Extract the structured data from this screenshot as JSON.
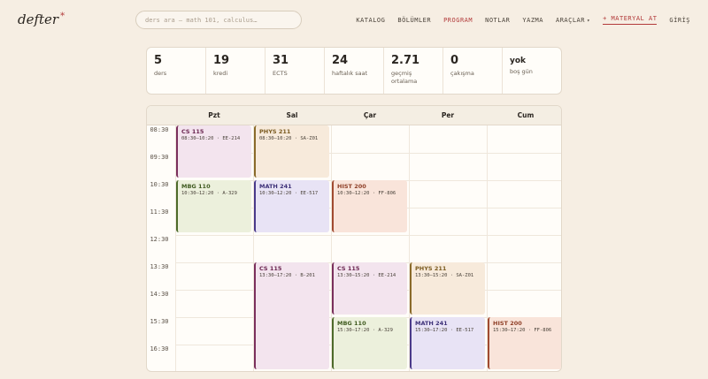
{
  "header": {
    "logo": "defter",
    "logo_mark": "*",
    "search_placeholder": "ders ara — math 101, calculus…",
    "nav": [
      {
        "label": "KATALOG",
        "state": "normal"
      },
      {
        "label": "BÖLÜMLER",
        "state": "normal"
      },
      {
        "label": "PROGRAM",
        "state": "active"
      },
      {
        "label": "NOTLAR",
        "state": "normal"
      },
      {
        "label": "YAZMA",
        "state": "normal"
      },
      {
        "label": "ARAÇLAR",
        "state": "dropdown"
      },
      {
        "label": "+ MATERYAL AT",
        "state": "accent"
      },
      {
        "label": "GİRİŞ",
        "state": "normal"
      }
    ]
  },
  "stats": [
    {
      "value": "5",
      "label": "ders"
    },
    {
      "value": "19",
      "label": "kredi"
    },
    {
      "value": "31",
      "label": "ECTS"
    },
    {
      "value": "24",
      "label": "haftalık saat"
    },
    {
      "value": "2.71",
      "label": "geçmiş ortalama"
    },
    {
      "value": "0",
      "label": "çakışma"
    },
    {
      "value": "yok",
      "label": "boş gün"
    }
  ],
  "calendar": {
    "days": [
      "Pzt",
      "Sal",
      "Çar",
      "Per",
      "Cum"
    ],
    "times": [
      "08:30",
      "09:30",
      "10:30",
      "11:30",
      "12:30",
      "13:30",
      "14:30",
      "15:30",
      "16:30"
    ],
    "events": [
      {
        "day": 0,
        "start": 0,
        "end": 2,
        "code": "CS 115",
        "detail": "08:30–10:20 · EE-214",
        "color": "cs"
      },
      {
        "day": 1,
        "start": 0,
        "end": 2,
        "code": "PHYS 211",
        "detail": "08:30–10:20 · SA-Z01",
        "color": "phys"
      },
      {
        "day": 0,
        "start": 2,
        "end": 4,
        "code": "MBG 110",
        "detail": "10:30–12:20 · A-329",
        "color": "mbg"
      },
      {
        "day": 1,
        "start": 2,
        "end": 4,
        "code": "MATH 241",
        "detail": "10:30–12:20 · EE-517",
        "color": "math"
      },
      {
        "day": 2,
        "start": 2,
        "end": 4,
        "code": "HIST 200",
        "detail": "10:30–12:20 · FF-806",
        "color": "hist"
      },
      {
        "day": 1,
        "start": 5,
        "end": 9,
        "code": "CS 115",
        "detail": "13:30–17:20 · B-201",
        "color": "cs"
      },
      {
        "day": 2,
        "start": 5,
        "end": 7,
        "code": "CS 115",
        "detail": "13:30–15:20 · EE-214",
        "color": "cs"
      },
      {
        "day": 3,
        "start": 5,
        "end": 7,
        "code": "PHYS 211",
        "detail": "13:30–15:20 · SA-Z01",
        "color": "phys"
      },
      {
        "day": 2,
        "start": 7,
        "end": 9,
        "code": "MBG 110",
        "detail": "15:30–17:20 · A-329",
        "color": "mbg"
      },
      {
        "day": 3,
        "start": 7,
        "end": 9,
        "code": "MATH 241",
        "detail": "15:30–17:20 · EE-517",
        "color": "math"
      },
      {
        "day": 4,
        "start": 7,
        "end": 9,
        "code": "HIST 200",
        "detail": "15:30–17:20 · FF-806",
        "color": "hist"
      }
    ],
    "colors": {
      "cs": {
        "bg": "#f3e4ee",
        "border": "#7a2f5c",
        "text": "#6a2550"
      },
      "phys": {
        "bg": "#f7eadb",
        "border": "#8a6a2a",
        "text": "#7a5a1f"
      },
      "mbg": {
        "bg": "#ecf0dc",
        "border": "#4d6a2a",
        "text": "#3f5a1f"
      },
      "math": {
        "bg": "#e8e3f5",
        "border": "#4a3a8a",
        "text": "#3d3078"
      },
      "hist": {
        "bg": "#f9e4da",
        "border": "#a04a30",
        "text": "#8f3f27"
      }
    }
  }
}
